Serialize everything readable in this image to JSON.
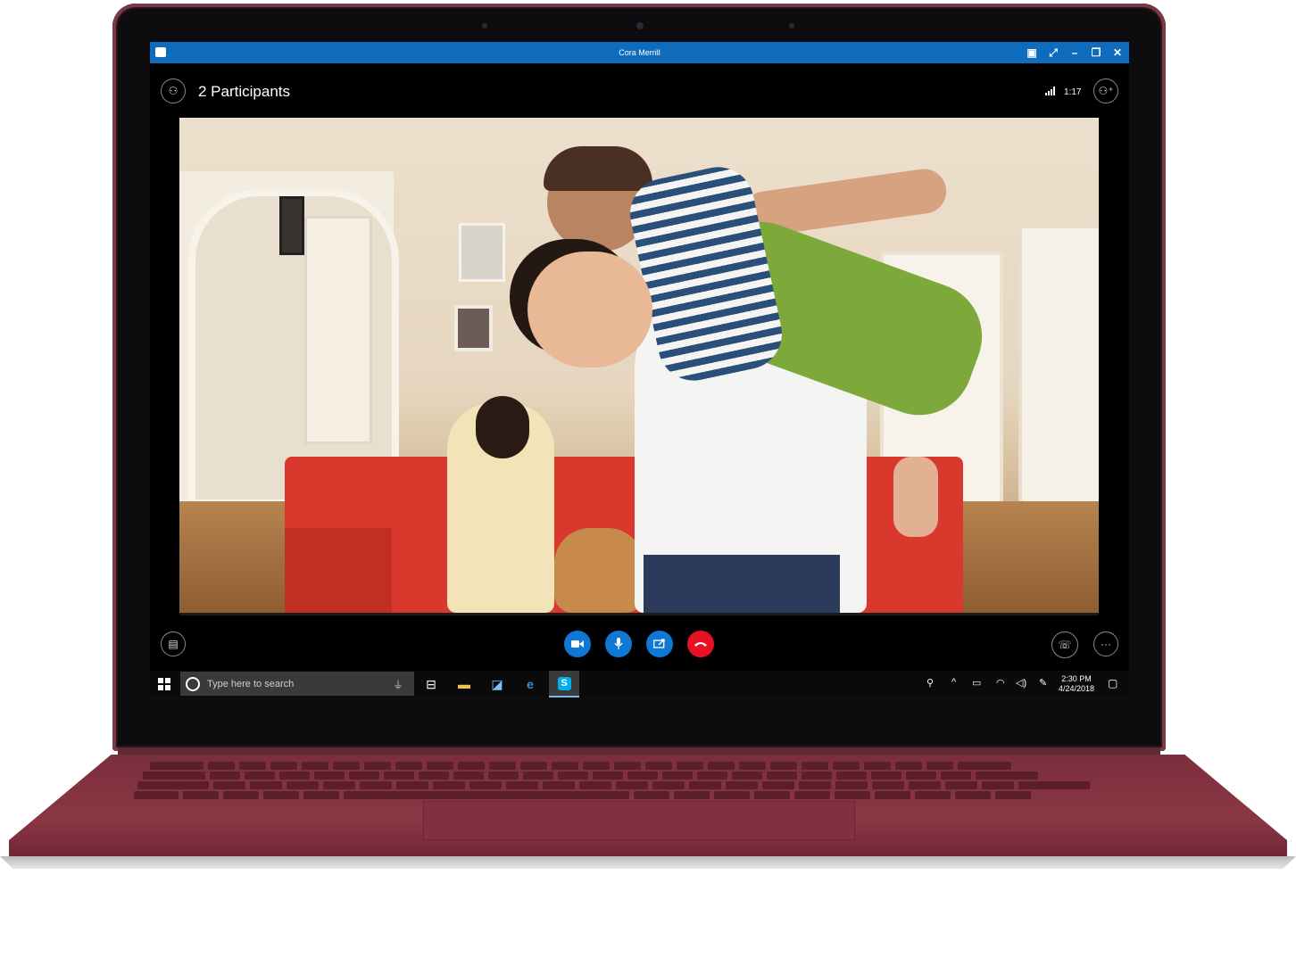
{
  "window": {
    "title": "Cora Merrill",
    "controls": [
      "snap-icon",
      "fullscreen-icon",
      "minimize-icon",
      "restore-icon",
      "close-icon"
    ]
  },
  "call": {
    "participants_label": "2 Participants",
    "duration": "1:17"
  },
  "controls": {
    "video": "video-camera-icon",
    "mic": "microphone-icon",
    "share": "share-screen-icon",
    "hangup": "hang-up-icon",
    "accent": "#0f78d4",
    "hangup_color": "#e81123"
  },
  "taskbar": {
    "search_placeholder": "Type here to search",
    "time": "2:30 PM",
    "date": "4/24/2018"
  }
}
